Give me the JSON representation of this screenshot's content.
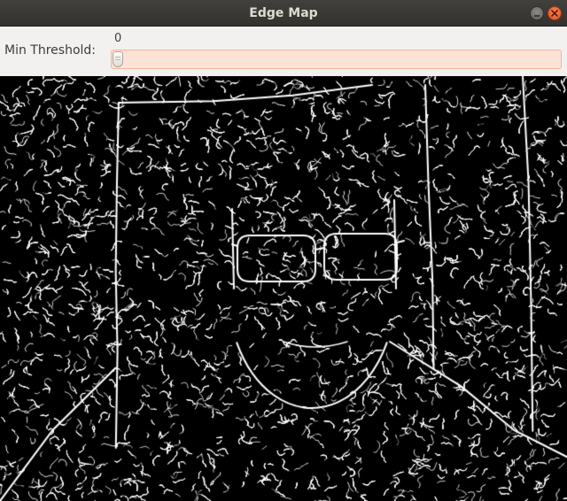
{
  "window": {
    "title": "Edge Map"
  },
  "controls": {
    "min_threshold": {
      "label": "Min Threshold:",
      "value": "0",
      "level": 0
    }
  },
  "icons": {
    "minimize": "minimize-icon",
    "close": "close-icon"
  },
  "colors": {
    "titlebar": "#3c3b37",
    "title_text": "#dfdbd2",
    "close_button": "#e95420",
    "slider_trough": "#fde3d7",
    "edge_background": "#000000",
    "edge_foreground": "#ffffff"
  },
  "image": {
    "description_kind": "edge-detected-face"
  }
}
